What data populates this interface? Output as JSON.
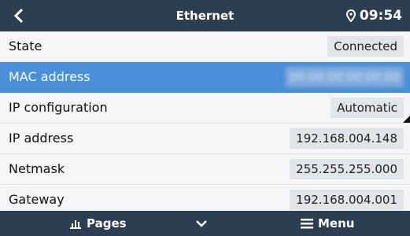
{
  "header": {
    "title": "Ethernet",
    "time": "09:54"
  },
  "rows": [
    {
      "label": "State",
      "value": "Connected"
    },
    {
      "label": "MAC address",
      "value": "00:00:00:00:00:00"
    },
    {
      "label": "IP configuration",
      "value": "Automatic"
    },
    {
      "label": "IP address",
      "value": "192.168.004.148"
    },
    {
      "label": "Netmask",
      "value": "255.255.255.000"
    },
    {
      "label": "Gateway",
      "value": "192.168.004.001"
    }
  ],
  "footer": {
    "pages_label": "Pages",
    "menu_label": "Menu"
  },
  "colors": {
    "bar": "#2c3e50",
    "selected": "#4a90d9"
  }
}
